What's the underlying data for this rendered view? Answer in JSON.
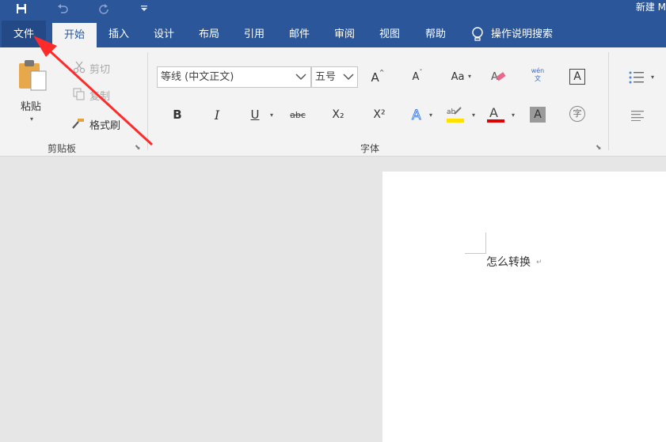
{
  "quick_access": {
    "icons": [
      "save-icon",
      "undo-icon",
      "redo-icon",
      "customize-icon"
    ]
  },
  "window": {
    "title": "新建 M"
  },
  "menu": {
    "file": "文件",
    "tabs": [
      "开始",
      "插入",
      "设计",
      "布局",
      "引用",
      "邮件",
      "审阅",
      "视图",
      "帮助"
    ],
    "active_tab": "开始",
    "tell_me": "操作说明搜索"
  },
  "clipboard": {
    "paste": "粘贴",
    "cut": "剪切",
    "copy": "复制",
    "format_painter": "格式刷",
    "label": "剪贴板"
  },
  "font": {
    "name": "等线 (中文正文)",
    "size": "五号",
    "label": "字体",
    "case_label": "Aa",
    "bold": "B",
    "italic": "I",
    "underline": "U",
    "strike": "abc",
    "sub": "X₂",
    "sup": "X²",
    "phonetic": "wén 文",
    "border_a": "A",
    "circle_char": "字"
  },
  "document": {
    "text": "怎么转换"
  },
  "colors": {
    "accent": "#2b579a",
    "highlight": "#ffe000",
    "font_color": "#e00000",
    "arrow": "#ff2a2a"
  }
}
